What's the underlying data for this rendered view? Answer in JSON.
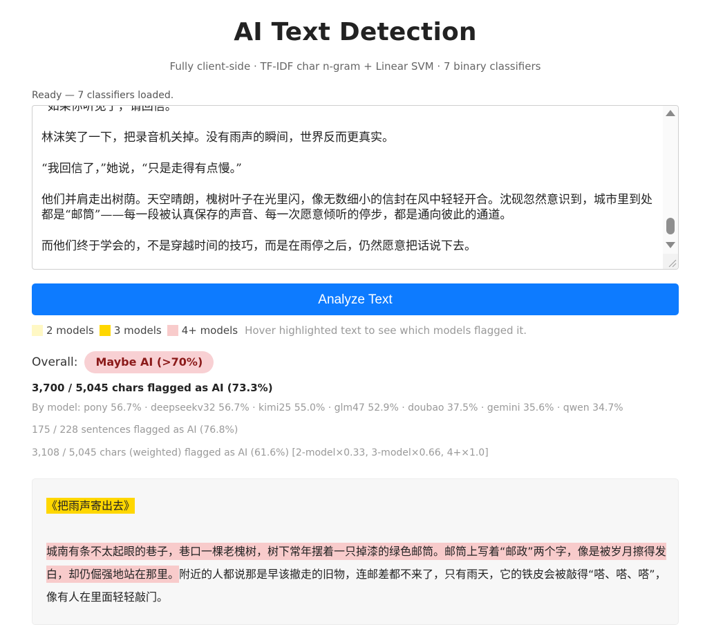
{
  "header": {
    "title": "AI Text Detection",
    "subtitle": "Fully client-side · TF-IDF char n-gram + Linear SVM · 7 binary classifiers"
  },
  "status": "Ready — 7 classifiers loaded.",
  "editor": {
    "partial_line": "“如果你听见了，请回信。”",
    "paragraphs": [
      "林沫笑了一下，把录音机关掉。没有雨声的瞬间，世界反而更真实。",
      "“我回信了，”她说，“只是走得有点慢。”",
      "他们并肩走出树荫。天空晴朗，槐树叶子在光里闪，像无数细小的信封在风中轻轻开合。沈砚忽然意识到，城市里到处都是“邮筒”——每一段被认真保存的声音、每一次愿意倾听的停步，都是通向彼此的通道。",
      "而他们终于学会的，不是穿越时间的技巧，而是在雨停之后，仍然愿意把话说下去。"
    ]
  },
  "analyze_button": "Analyze Text",
  "legend": {
    "items": [
      {
        "label": "2 models",
        "color": "#fff8c4"
      },
      {
        "label": "3 models",
        "color": "#ffd700"
      },
      {
        "label": "4+ models",
        "color": "#f8cbcb"
      }
    ],
    "hint": "Hover highlighted text to see which models flagged it."
  },
  "overall": {
    "label": "Overall:",
    "verdict": "Maybe AI (>70%)"
  },
  "stats": {
    "main": "3,700 / 5,045 chars flagged as AI (73.3%)",
    "by_model": "By model: pony 56.7% · deepseekv32 56.7% · kimi25 55.0% · glm47 52.9% · doubao 37.5% · gemini 35.6% · qwen 34.7%",
    "sentences": "175 / 228 sentences flagged as AI (76.8%)",
    "weighted": "3,108 / 5,045 chars (weighted) flagged as AI (61.6%) [2-model×0.33, 3-model×0.66, 4+×1.0]"
  },
  "result": {
    "title": "《把雨声寄出去》",
    "p1_hl1": "城南有条不太起眼的巷子，巷口一棵老槐树，树下常年摆着一只掉漆的绿色邮筒。",
    "p1_hl2": "邮筒上写着“邮政”两个字，像是被岁月擦得发白，却仍倔强地站在那里。",
    "p1_plain": "附近的人都说那是早该撤走的旧物，连邮差都不来了，只有雨天，它的铁皮会被敲得“嗒、嗒、嗒”，像有人在里面轻轻敲门。"
  }
}
